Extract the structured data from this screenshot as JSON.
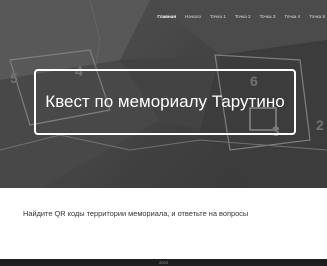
{
  "nav": {
    "items": [
      {
        "label": "Главная",
        "active": true
      },
      {
        "label": "Начало",
        "active": false
      },
      {
        "label": "Точка 1",
        "active": false
      },
      {
        "label": "Точка 2",
        "active": false
      },
      {
        "label": "Точка 3",
        "active": false
      },
      {
        "label": "Точка 4",
        "active": false
      },
      {
        "label": "Точка 5",
        "active": false
      }
    ]
  },
  "hero": {
    "title": "Квест по мемориалу Тарутино",
    "map_markers": [
      "5",
      "4",
      "6",
      "3",
      "2"
    ]
  },
  "main": {
    "description": "Найдите QR коды территории мемориала, и ответьте на вопросы"
  },
  "footer": {
    "text": "2023"
  },
  "colors": {
    "hero_overlay": "#4e4e4e",
    "footer_bg": "#1e1e1e",
    "text": "#333333"
  }
}
